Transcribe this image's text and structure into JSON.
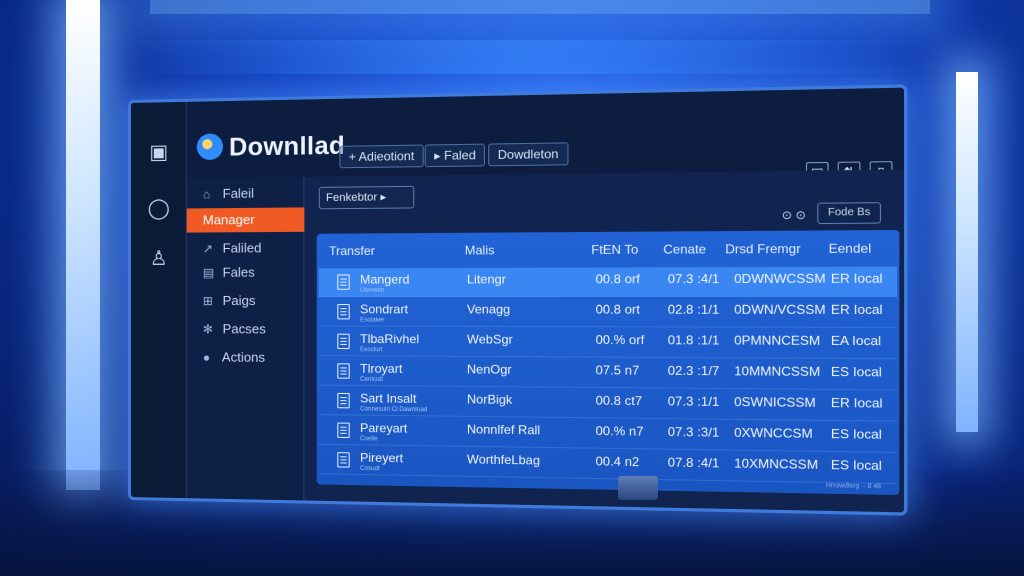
{
  "app": {
    "title": "Downllad"
  },
  "toolbar": {
    "buttons": [
      "+ Adieotiont",
      "▸ Faled",
      "Dowdleton"
    ]
  },
  "window_controls": [
    "▤",
    "⇅",
    "▯"
  ],
  "rail": [
    {
      "icon": "archive-icon",
      "glyph": "▣"
    },
    {
      "icon": "chat-icon",
      "glyph": "◯"
    },
    {
      "icon": "user-icon",
      "glyph": "♙"
    }
  ],
  "sidebar": {
    "items": [
      {
        "label": "Faleil",
        "icon": "user-outline-icon",
        "glyph": "⌂",
        "active": false
      },
      {
        "label": "Manager",
        "icon": "",
        "glyph": "",
        "active": true
      },
      {
        "label": "Faliled",
        "icon": "arrow-icon",
        "glyph": "↗",
        "active": false
      },
      {
        "label": "Fales",
        "icon": "file-icon",
        "glyph": "▤",
        "active": false
      },
      {
        "label": "Paigs",
        "icon": "grid-icon",
        "glyph": "⊞",
        "active": false
      },
      {
        "label": "Pacses",
        "icon": "gear-icon",
        "glyph": "✻",
        "active": false
      },
      {
        "label": "Actions",
        "icon": "people-icon",
        "glyph": "●",
        "active": false
      }
    ]
  },
  "search": {
    "value": "Fenkebtor ▸"
  },
  "filter": {
    "label": "Fode Bs",
    "icon_glyph": "⊙ ⊙"
  },
  "table": {
    "headers": [
      "Transfer",
      "Malis",
      "FtEN To",
      "Cenate",
      "Drsd Fremgr",
      "Eendel"
    ],
    "rows": [
      {
        "name": "Mangerd",
        "sub": "Uienwetr",
        "col2": "Litengr",
        "col3": "00.8 orf",
        "col4": "07.3 :4/1",
        "col5": "0DWNWCSSM",
        "col6": "ER Iocal",
        "highlight": true
      },
      {
        "name": "Sondrart",
        "sub": "Esoiaker",
        "col2": "Venagg",
        "col3": "00.8 ort",
        "col4": "02.8 :1/1",
        "col5": "0DWN/VCSSM",
        "col6": "ER Iocal",
        "highlight": false
      },
      {
        "name": "TlbaRivhel",
        "sub": "Eesclurt",
        "col2": "WebSgr",
        "col3": "00.% orf",
        "col4": "01.8 :1/1",
        "col5": "0PMNNCESM",
        "col6": "EA Iocal",
        "highlight": false
      },
      {
        "name": "Tlroyart",
        "sub": "Cenlcutt",
        "col2": "NenOgr",
        "col3": "07.5 n7",
        "col4": "02.3 :1/7",
        "col5": "10MMNCSSM",
        "col6": "ES Iocal",
        "highlight": false
      },
      {
        "name": "Sart Insalt",
        "sub": "Connesuin Cl Dawnload",
        "col2": "NorBigk",
        "col3": "00.8 ct7",
        "col4": "07.3 :1/1",
        "col5": "0SWNICSSM",
        "col6": "ER Iocal",
        "highlight": false
      },
      {
        "name": "Pareyart",
        "sub": "Coelle",
        "col2": "Nonnlfef Rall",
        "col3": "00.% n7",
        "col4": "07.3 :3/1",
        "col5": "0XWNCCSM",
        "col6": "ES Iocal",
        "highlight": false
      },
      {
        "name": "Pireyert",
        "sub": "Cosudt",
        "col2": "WorthfeLbag",
        "col3": "00.4 n2",
        "col4": "07.8 :4/1",
        "col5": "10XMNCSSM",
        "col6": "ES Iocal",
        "highlight": false
      }
    ],
    "footer": "Hrrowdlerg ·· 8 48"
  }
}
